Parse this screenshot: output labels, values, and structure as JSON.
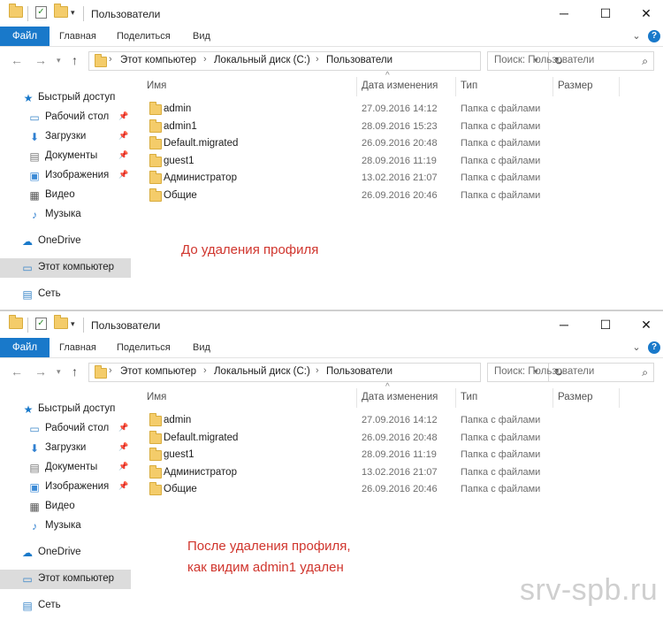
{
  "window_title": "Пользователи",
  "ribbon": {
    "file": "Файл",
    "home": "Главная",
    "share": "Поделиться",
    "view": "Вид"
  },
  "address": {
    "crumbs": [
      "Этот компьютер",
      "Локальный диск (C:)",
      "Пользователи"
    ]
  },
  "search": {
    "placeholder": "Поиск: Пользователи"
  },
  "nav": {
    "quick_access": "Быстрый доступ",
    "desktop": "Рабочий стол",
    "downloads": "Загрузки",
    "documents": "Документы",
    "pictures": "Изображения",
    "video": "Видео",
    "music": "Музыка",
    "onedrive": "OneDrive",
    "this_pc": "Этот компьютер",
    "network": "Сеть"
  },
  "columns": {
    "name": "Имя",
    "date": "Дата изменения",
    "type": "Тип",
    "size": "Размер"
  },
  "before": {
    "rows": [
      {
        "name": "admin",
        "date": "27.09.2016 14:12",
        "type": "Папка с файлами"
      },
      {
        "name": "admin1",
        "date": "28.09.2016 15:23",
        "type": "Папка с файлами"
      },
      {
        "name": "Default.migrated",
        "date": "26.09.2016 20:48",
        "type": "Папка с файлами"
      },
      {
        "name": "guest1",
        "date": "28.09.2016 11:19",
        "type": "Папка с файлами"
      },
      {
        "name": "Администратор",
        "date": "13.02.2016 21:07",
        "type": "Папка с файлами"
      },
      {
        "name": "Общие",
        "date": "26.09.2016 20:46",
        "type": "Папка с файлами"
      }
    ],
    "note": "До удаления профиля"
  },
  "after": {
    "rows": [
      {
        "name": "admin",
        "date": "27.09.2016 14:12",
        "type": "Папка с файлами"
      },
      {
        "name": "Default.migrated",
        "date": "26.09.2016 20:48",
        "type": "Папка с файлами"
      },
      {
        "name": "guest1",
        "date": "28.09.2016 11:19",
        "type": "Папка с файлами"
      },
      {
        "name": "Администратор",
        "date": "13.02.2016 21:07",
        "type": "Папка с файлами"
      },
      {
        "name": "Общие",
        "date": "26.09.2016 20:46",
        "type": "Папка с файлами"
      }
    ],
    "note_line1": "После удаления профиля,",
    "note_line2": "как видим admin1 удален"
  },
  "watermark": "srv-spb.ru",
  "colors": {
    "accent": "#1979ca",
    "note": "#d0352d",
    "folder": "#f4cc6a"
  },
  "icons": [
    "folder-icon",
    "properties-icon",
    "new-folder-icon",
    "minimize-icon",
    "maximize-icon",
    "close-icon",
    "back-icon",
    "forward-icon",
    "up-icon",
    "refresh-icon",
    "search-icon",
    "star-icon",
    "desktop-icon",
    "download-icon",
    "document-icon",
    "picture-icon",
    "video-icon",
    "music-icon",
    "onedrive-icon",
    "computer-icon",
    "network-icon",
    "pin-icon"
  ]
}
